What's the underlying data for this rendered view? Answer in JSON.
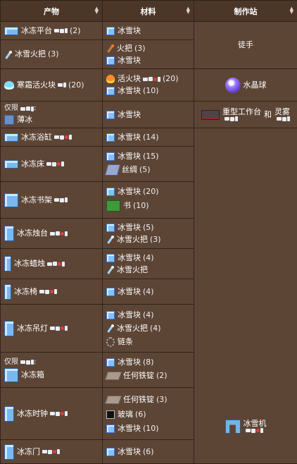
{
  "headers": {
    "product": "产物",
    "materials": "材料",
    "station": "制作站"
  },
  "stations": {
    "s1": "徒手",
    "s2": "水晶球",
    "s3_a": "重型工作台",
    "s3_and": "和",
    "s3_b": "灵雾",
    "s4": "冰雪机"
  },
  "rows": [
    {
      "product": "冰冻平台",
      "qty": "(2)",
      "mats": [
        {
          "n": "冰雪块",
          "q": ""
        }
      ]
    },
    {
      "product": "冰雪火把",
      "qty": "(3)",
      "mats": [
        {
          "n": "火把",
          "q": "(3)"
        },
        {
          "n": "冰雪块",
          "q": ""
        }
      ]
    },
    {
      "product": "寒霜活火块",
      "qty": "(20)",
      "mats": [
        {
          "n": "活火块",
          "q": "(20)"
        },
        {
          "n": "冰雪块",
          "q": "(10)"
        }
      ]
    },
    {
      "only": "仅限",
      "product": "薄冰",
      "qty": "",
      "mats": [
        {
          "n": "冰雪块",
          "q": ""
        }
      ]
    },
    {
      "product": "冰冻浴缸",
      "qty": "",
      "mats": [
        {
          "n": "冰雪块",
          "q": "(14)"
        }
      ]
    },
    {
      "product": "冰冻床",
      "qty": "",
      "mats": [
        {
          "n": "冰雪块",
          "q": "(15)"
        },
        {
          "n": "丝绸",
          "q": "(5)"
        }
      ]
    },
    {
      "product": "冰冻书架",
      "qty": "",
      "mats": [
        {
          "n": "冰雪块",
          "q": "(20)"
        },
        {
          "n": "书",
          "q": "(10)"
        }
      ]
    },
    {
      "product": "冰冻烛台",
      "qty": "",
      "mats": [
        {
          "n": "冰雪块",
          "q": "(5)"
        },
        {
          "n": "冰雪火把",
          "q": "(3)"
        }
      ]
    },
    {
      "product": "冰冻蜡烛",
      "qty": "",
      "mats": [
        {
          "n": "冰雪块",
          "q": "(4)"
        },
        {
          "n": "冰雪火把",
          "q": ""
        }
      ]
    },
    {
      "product": "冰冻椅",
      "qty": "",
      "mats": [
        {
          "n": "冰雪块",
          "q": "(4)"
        }
      ]
    },
    {
      "product": "冰冻吊灯",
      "qty": "",
      "mats": [
        {
          "n": "冰雪块",
          "q": "(4)"
        },
        {
          "n": "冰雪火把",
          "q": "(4)"
        },
        {
          "n": "链条",
          "q": ""
        }
      ]
    },
    {
      "only": "仅限",
      "product": "冰冻箱",
      "qty": "",
      "mats": [
        {
          "n": "冰雪块",
          "q": "(8)"
        },
        {
          "n": "任何铁锭",
          "q": "(2)"
        }
      ]
    },
    {
      "product": "冰冻时钟",
      "qty": "",
      "mats": [
        {
          "n": "任何铁锭",
          "q": "(3)"
        },
        {
          "n": "玻璃",
          "q": "(6)"
        },
        {
          "n": "冰雪块",
          "q": "(10)"
        }
      ]
    },
    {
      "product": "冰冻门",
      "qty": "",
      "mats": [
        {
          "n": "冰雪块",
          "q": "(6)"
        }
      ]
    }
  ]
}
